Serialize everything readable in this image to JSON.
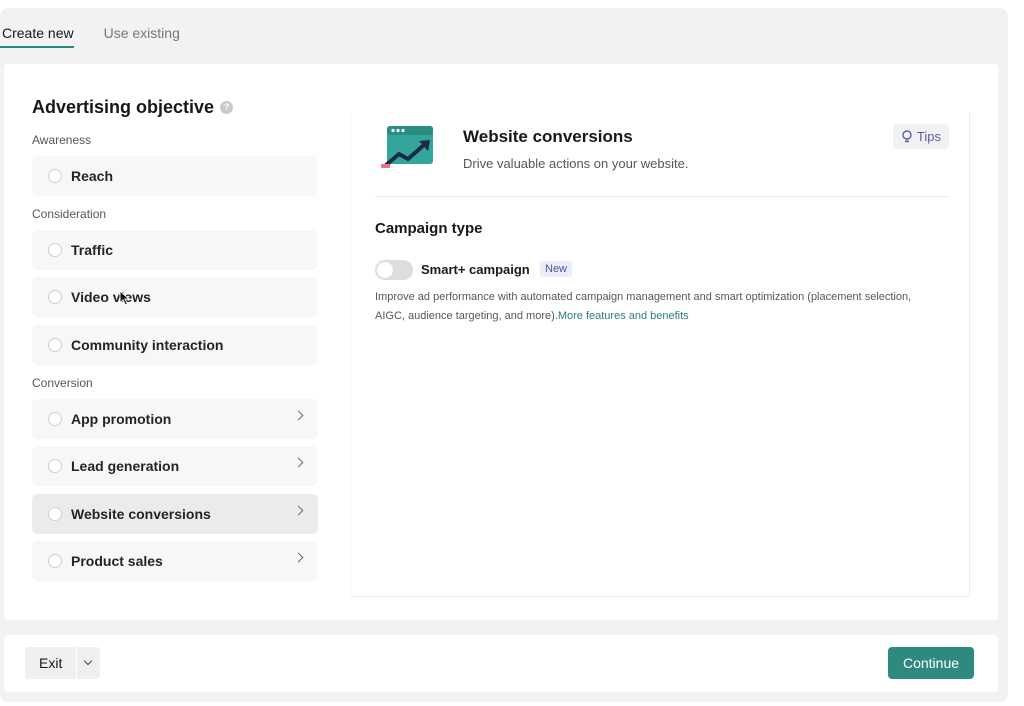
{
  "tabs": [
    {
      "label": "Create new",
      "active": true
    },
    {
      "label": "Use existing",
      "active": false
    }
  ],
  "objective": {
    "title": "Advertising objective",
    "help_icon": "question-circle-icon",
    "sections": {
      "awareness": "Awareness",
      "consideration": "Consideration",
      "conversion": "Conversion"
    },
    "options": {
      "reach": "Reach",
      "traffic": "Traffic",
      "video_views": "Video views",
      "community": "Community interaction",
      "app_promotion": "App promotion",
      "lead_generation": "Lead generation",
      "website_conversions": "Website conversions",
      "product_sales": "Product sales"
    },
    "selected": "Website conversions"
  },
  "detail": {
    "title": "Website conversions",
    "subtitle": "Drive valuable actions on your website.",
    "tips_label": "Tips",
    "campaign_type_heading": "Campaign type",
    "smart_label": "Smart+ campaign",
    "new_badge": "New",
    "smart_enabled": false,
    "description": "Improve ad performance with automated campaign management and smart optimization (placement selection, AIGC, audience targeting, and more).",
    "more_link": "More features and benefits"
  },
  "footer": {
    "exit_label": "Exit",
    "continue_label": "Continue"
  },
  "colors": {
    "accent": "#2e8a7e",
    "badge_text": "#4e54a6"
  }
}
